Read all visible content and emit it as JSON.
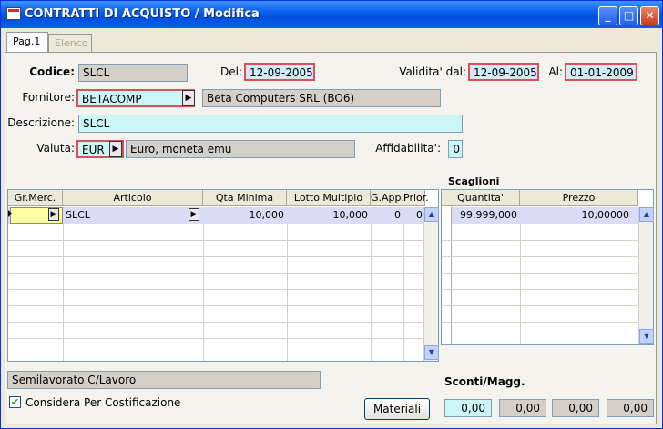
{
  "window": {
    "title": "CONTRATTI DI ACQUISTO / Modifica",
    "min": "_",
    "max": "□",
    "close": "✕"
  },
  "tabs": [
    {
      "label": "Pag.1"
    },
    {
      "label": "Elenco"
    }
  ],
  "form": {
    "codice_label": "Codice:",
    "codice": "SLCL",
    "del_label": "Del:",
    "del": "12-09-2005",
    "validita_label": "Validita' dal:",
    "validita": "12-09-2005",
    "al_label": "Al:",
    "al": "01-01-2009",
    "fornitore_label": "Fornitore:",
    "fornitore": "BETACOMP",
    "fornitore_desc": "Beta Computers SRL (BO6)",
    "descrizione_label": "Descrizione:",
    "descrizione": "SLCL",
    "valuta_label": "Valuta:",
    "valuta": "EUR",
    "valuta_desc": "Euro, moneta emu",
    "affidabilita_label": "Affidabilita':",
    "affidabilita": "0"
  },
  "articles": {
    "columns": [
      "Gr.Merc.",
      "Articolo",
      "Qta Minima",
      "Lotto Multiplo",
      "G.App.",
      "Prior."
    ],
    "rows": [
      {
        "gr": "",
        "articolo": "SLCL",
        "qta": "10,000",
        "lotto": "10,000",
        "gapp": "0",
        "prior": "0"
      }
    ]
  },
  "scaglioni": {
    "title": "Scaglioni",
    "columns": [
      "Quantita'",
      "Prezzo"
    ],
    "rows": [
      {
        "quantita": "99.999,000",
        "prezzo": "10,00000"
      }
    ]
  },
  "footer": {
    "semilavorato": "Semilavorato C/Lavoro",
    "considera": "Considera Per Costificazione",
    "materiali_button": "Materiali",
    "sconti_label": "Sconti/Magg.",
    "sconti": [
      "0,00",
      "0,00",
      "0,00",
      "0,00"
    ]
  }
}
